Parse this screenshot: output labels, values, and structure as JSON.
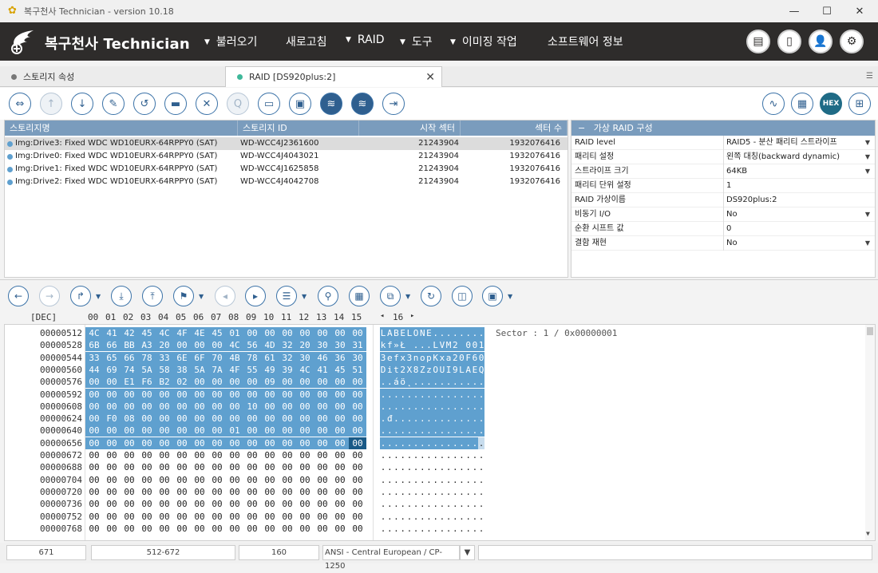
{
  "window": {
    "title": "복구천사 Technician - version 10.18",
    "controls": [
      "minimize-icon",
      "maximize-icon",
      "close-icon"
    ]
  },
  "header": {
    "brand": "복구천사 Technician",
    "menu": [
      {
        "label": "불러오기",
        "has_dropdown": true
      },
      {
        "label": "새로고침",
        "has_dropdown": false
      },
      {
        "label": "RAID",
        "has_dropdown": true
      },
      {
        "label": "도구",
        "has_dropdown": true
      },
      {
        "label": "이미징 작업",
        "has_dropdown": true
      },
      {
        "label": "소프트웨어 정보",
        "has_dropdown": false
      }
    ],
    "icons": [
      "card-icon",
      "sidebar-icon",
      "user-icon",
      "gear-icon"
    ]
  },
  "tabs": [
    {
      "label": "스토리지 속성",
      "dot_color": "#777777",
      "active": false
    },
    {
      "label": "RAID [DS920plus:2]",
      "dot_color": "#3fb89a",
      "active": true
    }
  ],
  "storage_table": {
    "columns": [
      "스토리지명",
      "스토리지 ID",
      "시작 섹터",
      "섹터 수"
    ],
    "rows": [
      {
        "name": "Img:Drive3: Fixed WDC WD10EURX-64RPPY0 (SAT)",
        "id": "WD-WCC4J2361600",
        "start": "21243904",
        "count": "1932076416",
        "selected": true
      },
      {
        "name": "Img:Drive0: Fixed WDC WD10EURX-64RPPY0 (SAT)",
        "id": "WD-WCC4J4043021",
        "start": "21243904",
        "count": "1932076416",
        "selected": false
      },
      {
        "name": "Img:Drive1: Fixed WDC WD10EURX-64RPPY0 (SAT)",
        "id": "WD-WCC4J1625858",
        "start": "21243904",
        "count": "1932076416",
        "selected": false
      },
      {
        "name": "Img:Drive2: Fixed WDC WD10EURX-64RPPY0 (SAT)",
        "id": "WD-WCC4J4042708",
        "start": "21243904",
        "count": "1932076416",
        "selected": false
      }
    ]
  },
  "raid_panel": {
    "title": "가상 RAID 구성",
    "props": [
      {
        "key": "RAID level",
        "value": "RAID5 - 분산 패리티 스트라이프",
        "dropdown": true
      },
      {
        "key": "패리티 설정",
        "value": "왼쪽 대칭(backward dynamic)",
        "dropdown": true
      },
      {
        "key": "스트라이프 크기",
        "value": "64KB",
        "dropdown": true
      },
      {
        "key": "패리티 단위 설정",
        "value": "1",
        "dropdown": false
      },
      {
        "key": "RAID 가상이름",
        "value": "DS920plus:2",
        "dropdown": false
      },
      {
        "key": "비동기 I/O",
        "value": "No",
        "dropdown": true
      },
      {
        "key": "순환 시프트 값",
        "value": "0",
        "dropdown": false
      },
      {
        "key": "결함 재현",
        "value": "No",
        "dropdown": true
      }
    ]
  },
  "hex_view": {
    "radix_label": "[DEC]",
    "column_headers": [
      "00",
      "01",
      "02",
      "03",
      "04",
      "05",
      "06",
      "07",
      "08",
      "09",
      "10",
      "11",
      "12",
      "13",
      "14",
      "15"
    ],
    "ascii_width_label": "16",
    "sector_info": "Sector : 1 / 0x00000001",
    "rows": [
      {
        "offset": "00000512",
        "hex": [
          "4C",
          "41",
          "42",
          "45",
          "4C",
          "4F",
          "4E",
          "45",
          "01",
          "00",
          "00",
          "00",
          "00",
          "00",
          "00",
          "00"
        ],
        "ascii": "LABELONE........"
      },
      {
        "offset": "00000528",
        "hex": [
          "6B",
          "66",
          "BB",
          "A3",
          "20",
          "00",
          "00",
          "00",
          "4C",
          "56",
          "4D",
          "32",
          "20",
          "30",
          "30",
          "31"
        ],
        "ascii": "kf»Ł ...LVM2 001"
      },
      {
        "offset": "00000544",
        "hex": [
          "33",
          "65",
          "66",
          "78",
          "33",
          "6E",
          "6F",
          "70",
          "4B",
          "78",
          "61",
          "32",
          "30",
          "46",
          "36",
          "30"
        ],
        "ascii": "3efx3nopKxa20F60"
      },
      {
        "offset": "00000560",
        "hex": [
          "44",
          "69",
          "74",
          "5A",
          "58",
          "38",
          "5A",
          "7A",
          "4F",
          "55",
          "49",
          "39",
          "4C",
          "41",
          "45",
          "51"
        ],
        "ascii": "Dit2X8ZzOUI9LAEQ"
      },
      {
        "offset": "00000576",
        "hex": [
          "00",
          "00",
          "E1",
          "F6",
          "B2",
          "02",
          "00",
          "00",
          "00",
          "00",
          "09",
          "00",
          "00",
          "00",
          "00",
          "00"
        ],
        "ascii": "..áö˛..........."
      },
      {
        "offset": "00000592",
        "hex": [
          "00",
          "00",
          "00",
          "00",
          "00",
          "00",
          "00",
          "00",
          "00",
          "00",
          "00",
          "00",
          "00",
          "00",
          "00",
          "00"
        ],
        "ascii": "................"
      },
      {
        "offset": "00000608",
        "hex": [
          "00",
          "00",
          "00",
          "00",
          "00",
          "00",
          "00",
          "00",
          "00",
          "10",
          "00",
          "00",
          "00",
          "00",
          "00",
          "00"
        ],
        "ascii": "................"
      },
      {
        "offset": "00000624",
        "hex": [
          "00",
          "F0",
          "08",
          "00",
          "00",
          "00",
          "00",
          "00",
          "00",
          "00",
          "00",
          "00",
          "00",
          "00",
          "00",
          "00"
        ],
        "ascii": ".đ.............."
      },
      {
        "offset": "00000640",
        "hex": [
          "00",
          "00",
          "00",
          "00",
          "00",
          "00",
          "00",
          "00",
          "01",
          "00",
          "00",
          "00",
          "00",
          "00",
          "00",
          "00"
        ],
        "ascii": "................"
      },
      {
        "offset": "00000656",
        "hex": [
          "00",
          "00",
          "00",
          "00",
          "00",
          "00",
          "00",
          "00",
          "00",
          "00",
          "00",
          "00",
          "00",
          "00",
          "00",
          "00"
        ],
        "ascii": "................"
      },
      {
        "offset": "00000672",
        "hex": [
          "00",
          "00",
          "00",
          "00",
          "00",
          "00",
          "00",
          "00",
          "00",
          "00",
          "00",
          "00",
          "00",
          "00",
          "00",
          "00"
        ],
        "ascii": "................"
      },
      {
        "offset": "00000688",
        "hex": [
          "00",
          "00",
          "00",
          "00",
          "00",
          "00",
          "00",
          "00",
          "00",
          "00",
          "00",
          "00",
          "00",
          "00",
          "00",
          "00"
        ],
        "ascii": "................"
      },
      {
        "offset": "00000704",
        "hex": [
          "00",
          "00",
          "00",
          "00",
          "00",
          "00",
          "00",
          "00",
          "00",
          "00",
          "00",
          "00",
          "00",
          "00",
          "00",
          "00"
        ],
        "ascii": "................"
      },
      {
        "offset": "00000720",
        "hex": [
          "00",
          "00",
          "00",
          "00",
          "00",
          "00",
          "00",
          "00",
          "00",
          "00",
          "00",
          "00",
          "00",
          "00",
          "00",
          "00"
        ],
        "ascii": "................"
      },
      {
        "offset": "00000736",
        "hex": [
          "00",
          "00",
          "00",
          "00",
          "00",
          "00",
          "00",
          "00",
          "00",
          "00",
          "00",
          "00",
          "00",
          "00",
          "00",
          "00"
        ],
        "ascii": "................"
      },
      {
        "offset": "00000752",
        "hex": [
          "00",
          "00",
          "00",
          "00",
          "00",
          "00",
          "00",
          "00",
          "00",
          "00",
          "00",
          "00",
          "00",
          "00",
          "00",
          "00"
        ],
        "ascii": "................"
      },
      {
        "offset": "00000768",
        "hex": [
          "00",
          "00",
          "00",
          "00",
          "00",
          "00",
          "00",
          "00",
          "00",
          "00",
          "00",
          "00",
          "00",
          "00",
          "00",
          "00"
        ],
        "ascii": "................"
      }
    ],
    "selected_row_count": 10
  },
  "status_bar": {
    "fields": [
      "671",
      "512-672",
      "160",
      "ANSI - Central European / CP-1250",
      ""
    ]
  },
  "colors": {
    "header_bg": "#2e2c2b",
    "table_header": "#7a9cbd",
    "selection": "#5fa0cf",
    "cursor": "#1a5a87",
    "accent": "#2f5f8f"
  }
}
